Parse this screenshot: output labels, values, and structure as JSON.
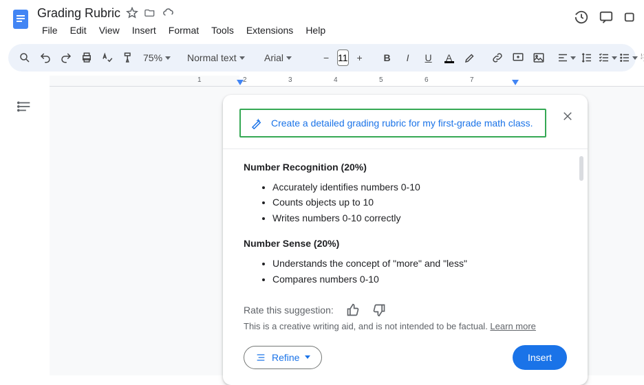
{
  "doc": {
    "title": "Grading Rubric"
  },
  "menus": [
    "File",
    "Edit",
    "View",
    "Insert",
    "Format",
    "Tools",
    "Extensions",
    "Help"
  ],
  "toolbar": {
    "zoom": "75%",
    "style": "Normal text",
    "font": "Arial",
    "font_size": "11"
  },
  "ruler": {
    "nums": [
      "1",
      "2",
      "3",
      "4",
      "5",
      "6",
      "7"
    ]
  },
  "panel": {
    "prompt": "Create a detailed grading rubric for my first-grade math class.",
    "section1_title": "Number Recognition (20%)",
    "section1_items": [
      "Accurately identifies numbers 0-10",
      "Counts objects up to 10",
      "Writes numbers 0-10 correctly"
    ],
    "section2_title": "Number Sense (20%)",
    "section2_items": [
      "Understands the concept of \"more\" and \"less\"",
      "Compares numbers 0-10"
    ],
    "rating_label": "Rate this suggestion:",
    "disclaimer_text": "This is a creative writing aid, and is not intended to be factual. ",
    "learn_more": "Learn more",
    "refine_label": "Refine",
    "insert_label": "Insert"
  }
}
